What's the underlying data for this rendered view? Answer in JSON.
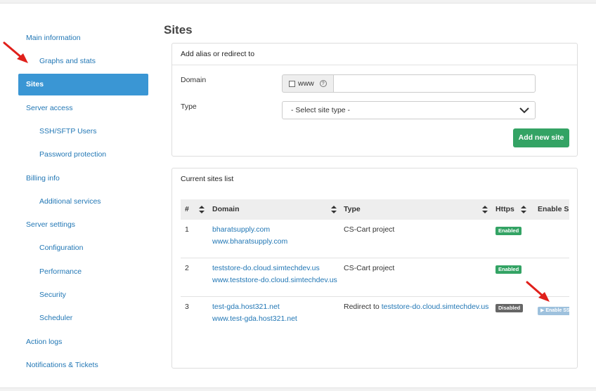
{
  "sidebar": {
    "items": [
      {
        "label": "Main information",
        "sub": false,
        "active": false
      },
      {
        "label": "Graphs and stats",
        "sub": true,
        "active": false
      },
      {
        "label": "Sites",
        "sub": false,
        "active": true
      },
      {
        "label": "Server access",
        "sub": false,
        "active": false
      },
      {
        "label": "SSH/SFTP Users",
        "sub": true,
        "active": false
      },
      {
        "label": "Password protection",
        "sub": true,
        "active": false
      },
      {
        "label": "Billing info",
        "sub": false,
        "active": false
      },
      {
        "label": "Additional services",
        "sub": true,
        "active": false
      },
      {
        "label": "Server settings",
        "sub": false,
        "active": false
      },
      {
        "label": "Configuration",
        "sub": true,
        "active": false
      },
      {
        "label": "Performance",
        "sub": true,
        "active": false
      },
      {
        "label": "Security",
        "sub": true,
        "active": false
      },
      {
        "label": "Scheduler",
        "sub": true,
        "active": false
      },
      {
        "label": "Action logs",
        "sub": false,
        "active": false
      },
      {
        "label": "Notifications & Tickets",
        "sub": false,
        "active": false
      }
    ]
  },
  "page": {
    "title": "Sites"
  },
  "add_panel": {
    "heading": "Add alias or redirect to",
    "domain_label": "Domain",
    "www_label": "www",
    "help_glyph": "?",
    "domain_value": "",
    "type_label": "Type",
    "type_selected": "- Select site type -",
    "add_button": "Add new site"
  },
  "list_panel": {
    "heading": "Current sites list",
    "columns": [
      "#",
      "Domain",
      "Type",
      "Https",
      "Enable S"
    ],
    "rows": [
      {
        "num": "1",
        "domain": "bharatsupply.com",
        "alias": "www.bharatsupply.com",
        "type_text": "CS-Cart project",
        "type_link": "",
        "https": "Enabled",
        "https_status": "enabled",
        "action": ""
      },
      {
        "num": "2",
        "domain": "teststore-do.cloud.simtechdev.us",
        "alias": "www.teststore-do.cloud.simtechdev.us",
        "type_text": "CS-Cart project",
        "type_link": "",
        "https": "Enabled",
        "https_status": "enabled",
        "action": ""
      },
      {
        "num": "3",
        "domain": "test-gda.host321.net",
        "alias": "www.test-gda.host321.net",
        "type_text": "Redirect to ",
        "type_link": "teststore-do.cloud.simtechdev.us",
        "https": "Disabled",
        "https_status": "disabled",
        "action": "▶ Enable SS"
      }
    ]
  },
  "colors": {
    "accent": "#3a96d4",
    "link": "#2277b5",
    "success": "#33a364",
    "disabled": "#666666",
    "annotation_arrow": "#e0201b"
  }
}
